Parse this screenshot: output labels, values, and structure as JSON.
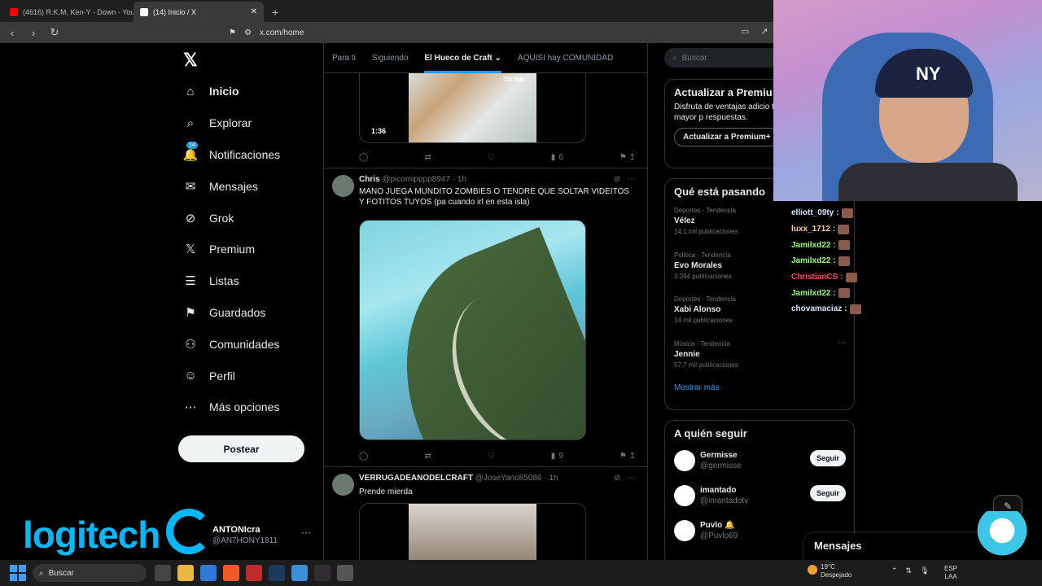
{
  "browser": {
    "tabs": [
      {
        "title": "(4616) R.K.M, Ken-Y - Down - YouTub",
        "icon": "youtube-icon",
        "color": "#ff0000"
      },
      {
        "title": "(14) Inicio / X",
        "icon": "x-icon",
        "color": "#ffffff"
      }
    ],
    "new_tab": "+",
    "url": "x.com/home"
  },
  "sidebar": {
    "logo": "𝕏",
    "items": [
      {
        "label": "Inicio",
        "icon": "home-icon",
        "glyph": "⌂"
      },
      {
        "label": "Explorar",
        "icon": "search-icon",
        "glyph": "⌕"
      },
      {
        "label": "Notificaciones",
        "icon": "bell-icon",
        "glyph": "🔔",
        "badge": "14"
      },
      {
        "label": "Mensajes",
        "icon": "mail-icon",
        "glyph": "✉"
      },
      {
        "label": "Grok",
        "icon": "grok-icon",
        "glyph": "⊘"
      },
      {
        "label": "Premium",
        "icon": "x-premium-icon",
        "glyph": "𝕏"
      },
      {
        "label": "Listas",
        "icon": "list-icon",
        "glyph": "☰"
      },
      {
        "label": "Guardados",
        "icon": "bookmark-icon",
        "glyph": "⚑"
      },
      {
        "label": "Comunidades",
        "icon": "communities-icon",
        "glyph": "⚇"
      },
      {
        "label": "Perfil",
        "icon": "person-icon",
        "glyph": "☺"
      },
      {
        "label": "Más opciones",
        "icon": "more-circle-icon",
        "glyph": "⋯"
      }
    ],
    "post_button": "Postear",
    "profile": {
      "name": "ANTONIcra",
      "handle": "@AN7HONY1811",
      "more": "···"
    }
  },
  "overlay": {
    "logitech": "logitech"
  },
  "main": {
    "tabs": [
      "Para ti",
      "Siguiendo",
      "El Hueco de Craft",
      "AQUISI hay COMUNIDAD"
    ],
    "top_media": {
      "duration": "1:36",
      "watermark": "TikTok"
    },
    "top_actions": {
      "views": "6"
    },
    "tweet1": {
      "name": "Chris",
      "handle": "@picomipppp8947 · 1h",
      "text": "MANO JUEGA MUNDITO ZOMBIES O TENDRE QUE SOLTAR VIDEITOS Y FOTITOS TUYOS (pa cuando irl en esta isla)",
      "views": "9"
    },
    "tweet2": {
      "name": "VERRUGADEANODELCRAFT",
      "handle": "@JoseYano85086 · 1h",
      "text": "Prende mierda"
    }
  },
  "right": {
    "search_placeholder": "Buscar",
    "premium": {
      "title": "Actualizar a Premiu",
      "desc": "Disfruta de ventajas adicio total de anuncios y mayor p respuestas.",
      "button": "Actualizar a Premium+"
    },
    "trends_title": "Qué está pasando",
    "trends": [
      {
        "cat": "Deportes · Tendencia",
        "title": "Vélez",
        "count": "14,1 mil publicaciones"
      },
      {
        "cat": "Política · Tendencia",
        "title": "Evo Morales",
        "count": "3.394 publicaciones"
      },
      {
        "cat": "Deportes · Tendencia",
        "title": "Xabi Alonso",
        "count": "14 mil publicaciones"
      },
      {
        "cat": "Música · Tendencia",
        "title": "Jennie",
        "count": "57,7 mil publicaciones"
      }
    ],
    "show_more": "Mostrar más",
    "follow_title": "A quién seguir",
    "follow": [
      {
        "name": "Germisse",
        "handle": "@germisse",
        "button": "Seguir"
      },
      {
        "name": "imantado",
        "handle": "@imantadotv",
        "button": "Seguir"
      },
      {
        "name": "Puvlo 🔔",
        "handle": "@Puvlo69",
        "button": ""
      }
    ]
  },
  "stream": {
    "cap_logo": "NY",
    "chat": [
      {
        "user": "elliott_09ty",
        "color": "#d8e8ff"
      },
      {
        "user": "luxx_1712",
        "color": "#ffd0a0"
      },
      {
        "user": "Jamilxd22",
        "color": "#9cff70"
      },
      {
        "user": "Jamilxd22",
        "color": "#9cff70"
      },
      {
        "user": "ChristianCS",
        "color": "#ff4a60"
      },
      {
        "user": "Jamilxd22",
        "color": "#9cff70"
      },
      {
        "user": "chovamaciaz",
        "color": "#d8e8ff"
      }
    ],
    "messages_label": "Mensajes"
  },
  "taskbar": {
    "search": "Buscar",
    "weather_temp": "19°C",
    "weather_desc": "Despejado",
    "lang1": "ESP",
    "lang2": "LAA"
  }
}
